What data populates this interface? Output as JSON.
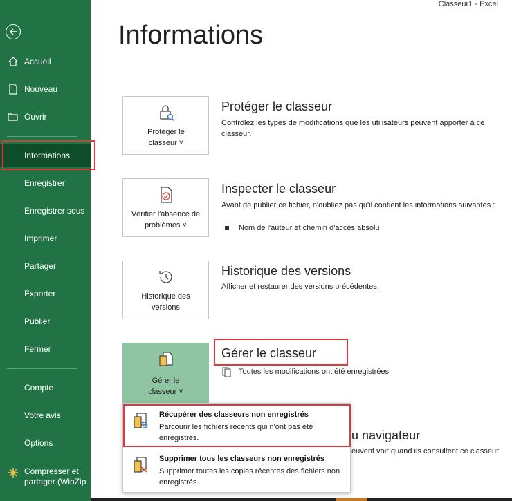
{
  "titlebar": {
    "doc": "Classeur1",
    "sep": "-",
    "app": "Excel"
  },
  "sidebar": {
    "items": [
      {
        "label": "Accueil",
        "icon": "home-icon"
      },
      {
        "label": "Nouveau",
        "icon": "new-file-icon"
      },
      {
        "label": "Ouvrir",
        "icon": "folder-open-icon"
      },
      {
        "label": "Informations",
        "active": true
      },
      {
        "label": "Enregistrer"
      },
      {
        "label": "Enregistrer sous"
      },
      {
        "label": "Imprimer"
      },
      {
        "label": "Partager"
      },
      {
        "label": "Exporter"
      },
      {
        "label": "Publier"
      },
      {
        "label": "Fermer"
      },
      {
        "label": "Compte"
      },
      {
        "label": "Votre avis"
      },
      {
        "label": "Options"
      },
      {
        "label": "Compresser et partager (WinZip",
        "icon": "winzip-icon"
      }
    ]
  },
  "main": {
    "title": "Informations",
    "protect": {
      "card_label": "Protéger le classeur ˅",
      "title": "Protéger le classeur",
      "text": "Contrôlez les types de modifications que les utilisateurs peuvent apporter à ce classeur."
    },
    "inspect": {
      "card_label": "Vérifier l'absence de problèmes ˅",
      "title": "Inspecter le classeur",
      "text": "Avant de publier ce fichier, n'oubliez pas qu'il contient les informations suivantes :",
      "bullet": "Nom de l'auteur et chemin d'accès absolu"
    },
    "history": {
      "card_label": "Historique des versions",
      "title": "Historique des versions",
      "text": "Afficher et restaurer des versions précédentes."
    },
    "manage": {
      "card_label": "Gérer le classeur ˅",
      "title": "Gérer le classeur",
      "text": "Toutes les modifications ont été enregistrées."
    },
    "browser": {
      "title_partial": "u navigateur",
      "text_partial": "euvent voir quand ils consultent ce classeur"
    },
    "dropdown": {
      "items": [
        {
          "title": "Récupérer des classeurs non enregistrés",
          "desc": "Parcourir les fichiers récents qui n'ont pas été enregistrés."
        },
        {
          "title": "Supprimer tous les classeurs non enregistrés",
          "desc": "Supprimer toutes les copies récentes des fichiers non enregistrés."
        }
      ]
    }
  },
  "colors": {
    "sidebar": "#217346",
    "active": "#0e4d2a",
    "highlight": "#e0373a",
    "manage_card": "#8fc5a2"
  }
}
